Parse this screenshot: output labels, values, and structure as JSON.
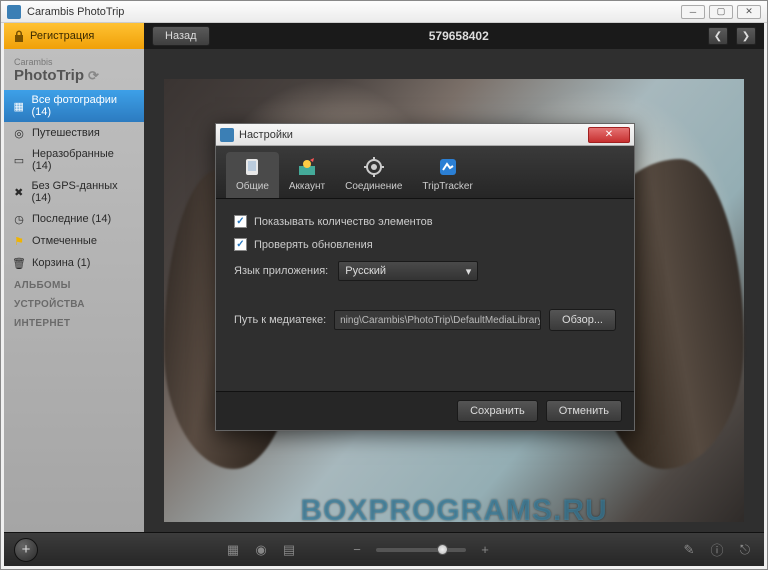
{
  "window": {
    "title": "Carambis PhotoTrip"
  },
  "topbar": {
    "register": "Регистрация",
    "back": "Назад",
    "path_title": "579658402"
  },
  "brand": {
    "vendor": "Carambis",
    "product": "PhotoTrip"
  },
  "sidebar": {
    "items": [
      {
        "icon": "photos-icon",
        "glyph": "▦",
        "label": "Все фотографии (14)",
        "active": true
      },
      {
        "icon": "camera-icon",
        "glyph": "◎",
        "label": "Путешествия"
      },
      {
        "icon": "unsorted-icon",
        "glyph": "▭",
        "label": "Неразобранные (14)"
      },
      {
        "icon": "no-gps-icon",
        "glyph": "✖",
        "label": "Без GPS-данных (14)"
      },
      {
        "icon": "recent-icon",
        "glyph": "◷",
        "label": "Последние (14)"
      },
      {
        "icon": "flag-icon",
        "glyph": "⚑",
        "label": "Отмеченные",
        "flag_color": "#f0b400"
      },
      {
        "icon": "trash-icon",
        "glyph": "🗑",
        "label": "Корзина (1)"
      }
    ],
    "sections": [
      "АЛЬБОМЫ",
      "УСТРОЙСТВА",
      "ИНТЕРНЕТ"
    ]
  },
  "watermark": "BOXPROGRAMS.RU",
  "dialog": {
    "title": "Настройки",
    "tabs": [
      {
        "label": "Общие",
        "active": true
      },
      {
        "label": "Аккаунт"
      },
      {
        "label": "Соединение"
      },
      {
        "label": "TripTracker"
      }
    ],
    "check_count": "Показывать количество элементов",
    "check_updates": "Проверять обновления",
    "lang_label": "Язык приложения:",
    "lang_value": "Русский",
    "path_label": "Путь к медиатеке:",
    "path_value": "ning\\Carambis\\PhotoTrip\\DefaultMediaLibrary",
    "browse": "Обзор...",
    "save": "Сохранить",
    "cancel": "Отменить"
  }
}
